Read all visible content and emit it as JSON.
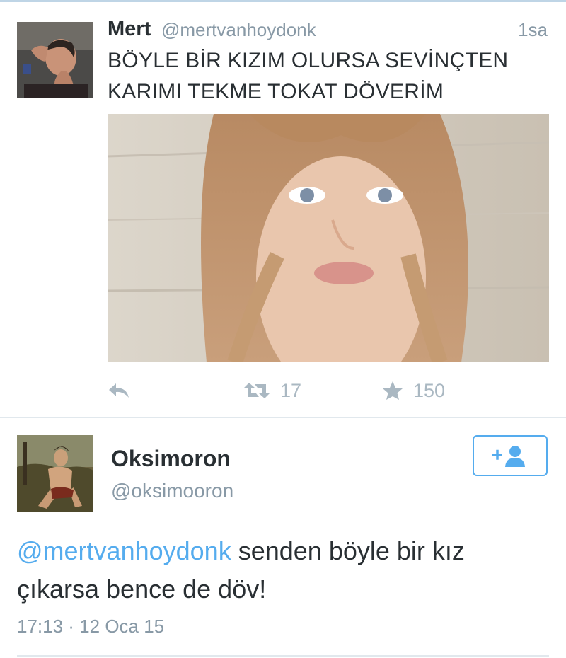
{
  "tweet": {
    "name": "Mert",
    "handle": "@mertvanhoydonk",
    "time": "1sa",
    "text_line1": "BÖYLE BİR KIZIM OLURSA SEVİNÇTEN",
    "text_line2": "KARIMI TEKME TOKAT DÖVERİM",
    "actions": {
      "reply_icon": "reply-icon",
      "retweet_icon": "retweet-icon",
      "retweet_count": "17",
      "favorite_icon": "star-icon",
      "favorite_count": "150"
    }
  },
  "reply_tweet": {
    "name": "Oksimoron",
    "handle": "@oksimooron",
    "follow_icon": "add-user-icon",
    "mention": "@mertvanhoydonk",
    "text_part1": " senden böyle bir kız",
    "text_part2": "çıkarsa bence de döv!",
    "timestamp": "17:13 · 12 Oca 15"
  },
  "colors": {
    "accent": "#55acee",
    "muted": "#8899a6",
    "icon": "#aab8c2",
    "text": "#292f33"
  }
}
